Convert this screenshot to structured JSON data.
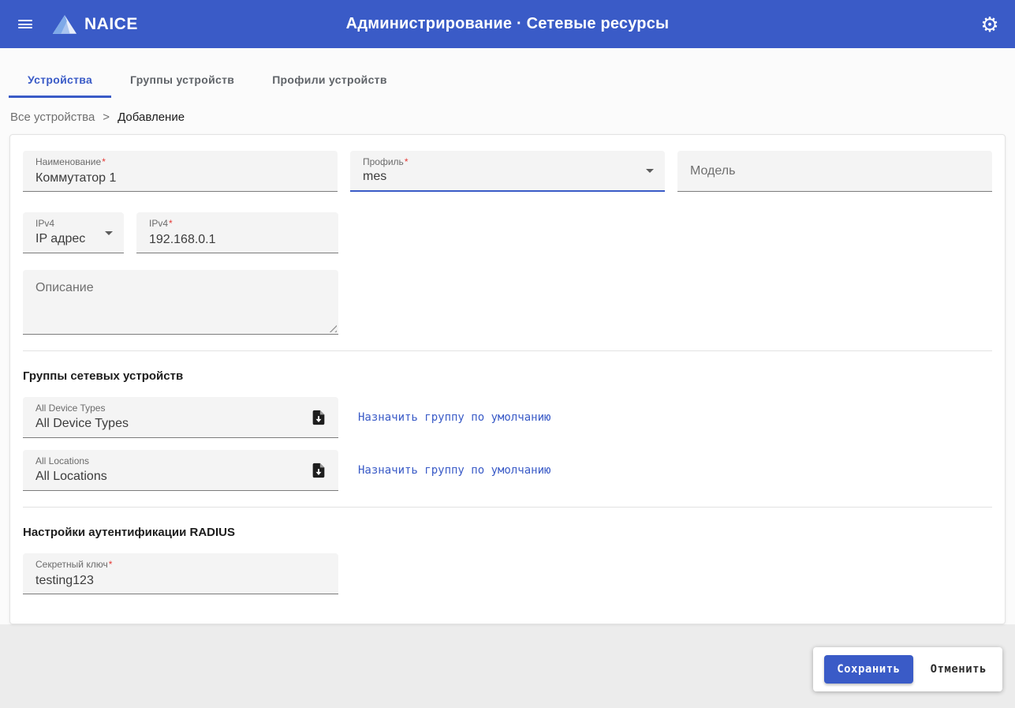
{
  "appbar": {
    "brand": "NAICE",
    "title": "Администрирование · Сетевые ресурсы"
  },
  "tabs": [
    {
      "label": "Устройства",
      "active": true
    },
    {
      "label": "Группы устройств",
      "active": false
    },
    {
      "label": "Профили устройств",
      "active": false
    }
  ],
  "breadcrumb": {
    "parent": "Все устройства",
    "separator": ">",
    "current": "Добавление"
  },
  "form": {
    "name": {
      "label": "Наименование",
      "required": "*",
      "value": "Коммутатор 1"
    },
    "profile": {
      "label": "Профиль",
      "required": "*",
      "value": "mes"
    },
    "model": {
      "label": "Модель",
      "value": ""
    },
    "ip_type": {
      "label": "IPv4",
      "value": "IP адрес"
    },
    "ip": {
      "label": "IPv4",
      "required": "*",
      "value": "192.168.0.1"
    },
    "description": {
      "placeholder": "Описание",
      "value": ""
    },
    "groups_heading": "Группы сетевых устройств",
    "groups": [
      {
        "label": "All Device Types",
        "value": "All Device Types",
        "action": "Назначить группу по умолчанию"
      },
      {
        "label": "All Locations",
        "value": "All Locations",
        "action": "Назначить группу по умолчанию"
      }
    ],
    "radius_heading": "Настройки аутентификации RADIUS",
    "secret": {
      "label": "Секретный ключ",
      "required": "*",
      "value": "testing123"
    }
  },
  "actions": {
    "save": "Сохранить",
    "cancel": "Отменить"
  },
  "colors": {
    "appbar": "#3a5bc7",
    "accent": "#3a5bc7",
    "required": "#e53935"
  }
}
